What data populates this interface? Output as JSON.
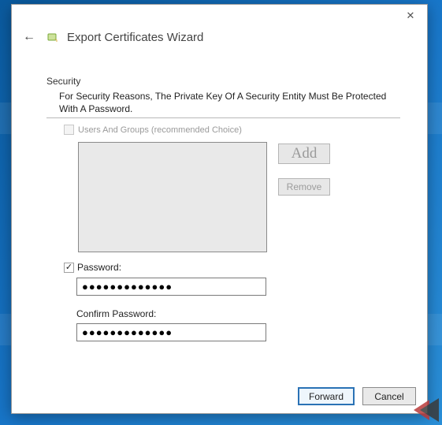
{
  "window": {
    "title": "Export Certificates Wizard"
  },
  "section": {
    "heading": "Security",
    "description": "For Security Reasons, The Private Key Of A Security Entity Must Be Protected With A Password."
  },
  "usersGroups": {
    "checked": false,
    "label": "Users And Groups (recommended Choice)"
  },
  "buttons": {
    "add": "Add",
    "remove": "Remove",
    "forward": "Forward",
    "cancel": "Cancel"
  },
  "passwordBlock": {
    "checked": true,
    "label": "Password:",
    "value": "●●●●●●●●●●●●●",
    "confirmLabel": "Confirm Password:",
    "confirmValue": "●●●●●●●●●●●●●"
  }
}
